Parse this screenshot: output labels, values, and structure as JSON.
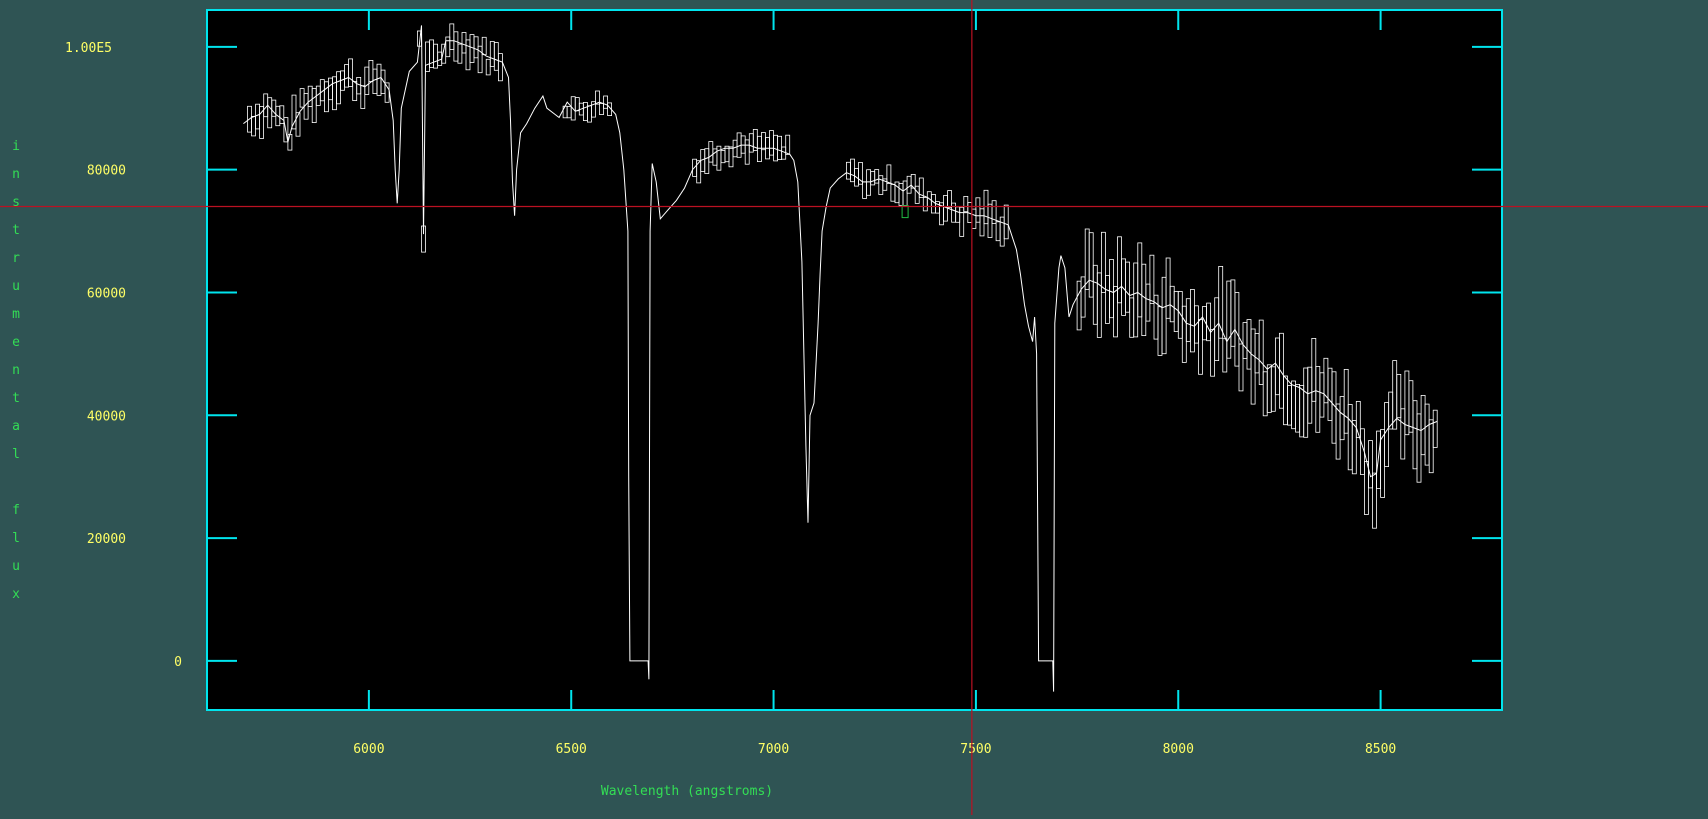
{
  "colors": {
    "background": "#2f5454",
    "plot_bg": "#000000",
    "frame": "#00e5ee",
    "tick_label": "#ffff66",
    "axis_label": "#33dd55",
    "spectrum": "#ffffff",
    "cursor": "#bb1122",
    "marker": "#22bb44"
  },
  "chart_data": {
    "type": "line",
    "xlabel": "Wavelength (angstroms)",
    "ylabel": "instrumental flux",
    "xlim": [
      5600,
      8800
    ],
    "ylim": [
      -8000,
      106000
    ],
    "x_ticks": [
      {
        "value": 6000,
        "label": "6000"
      },
      {
        "value": 6500,
        "label": "6500"
      },
      {
        "value": 7000,
        "label": "7000"
      },
      {
        "value": 7500,
        "label": "7500"
      },
      {
        "value": 8000,
        "label": "8000"
      },
      {
        "value": 8500,
        "label": "8500"
      }
    ],
    "y_ticks": [
      {
        "value": 0,
        "label": "0"
      },
      {
        "value": 20000,
        "label": "20000"
      },
      {
        "value": 40000,
        "label": "40000"
      },
      {
        "value": 60000,
        "label": "60000"
      },
      {
        "value": 80000,
        "label": "80000"
      },
      {
        "value": 100000,
        "label": "1.00E5"
      }
    ],
    "cursor": {
      "x": 7490,
      "y": 74000
    },
    "marker_point": {
      "x": 7325,
      "y": 73500
    },
    "series": [
      {
        "points": [
          [
            5690,
            87500
          ],
          [
            5710,
            88500
          ],
          [
            5730,
            89000
          ],
          [
            5750,
            90500
          ],
          [
            5770,
            89000
          ],
          [
            5790,
            88000
          ],
          [
            5800,
            84500
          ],
          [
            5810,
            87000
          ],
          [
            5830,
            89500
          ],
          [
            5850,
            91000
          ],
          [
            5870,
            92000
          ],
          [
            5890,
            93000
          ],
          [
            5910,
            94000
          ],
          [
            5930,
            94500
          ],
          [
            5950,
            95000
          ],
          [
            5970,
            94000
          ],
          [
            5990,
            93500
          ],
          [
            6010,
            94500
          ],
          [
            6030,
            95000
          ],
          [
            6050,
            93000
          ],
          [
            6060,
            88000
          ],
          [
            6065,
            80000
          ],
          [
            6070,
            74500
          ],
          [
            6075,
            80000
          ],
          [
            6080,
            90000
          ],
          [
            6100,
            96000
          ],
          [
            6120,
            97500
          ],
          [
            6130,
            103500
          ],
          [
            6135,
            69500
          ],
          [
            6140,
            97000
          ],
          [
            6160,
            97500
          ],
          [
            6180,
            98000
          ],
          [
            6190,
            101000
          ],
          [
            6210,
            101000
          ],
          [
            6230,
            100500
          ],
          [
            6250,
            100000
          ],
          [
            6270,
            99500
          ],
          [
            6290,
            98500
          ],
          [
            6310,
            98000
          ],
          [
            6330,
            97500
          ],
          [
            6345,
            95000
          ],
          [
            6350,
            88000
          ],
          [
            6355,
            78000
          ],
          [
            6360,
            72500
          ],
          [
            6365,
            80000
          ],
          [
            6375,
            86000
          ],
          [
            6390,
            87500
          ],
          [
            6410,
            90000
          ],
          [
            6430,
            92000
          ],
          [
            6440,
            90000
          ],
          [
            6460,
            89000
          ],
          [
            6470,
            88500
          ],
          [
            6490,
            91000
          ],
          [
            6510,
            89500
          ],
          [
            6530,
            90000
          ],
          [
            6550,
            90500
          ],
          [
            6570,
            91000
          ],
          [
            6590,
            90500
          ],
          [
            6610,
            89000
          ],
          [
            6620,
            86000
          ],
          [
            6630,
            80000
          ],
          [
            6640,
            70000
          ],
          [
            6642,
            30000
          ],
          [
            6645,
            0
          ],
          [
            6690,
            0
          ],
          [
            6692,
            -3000
          ],
          [
            6695,
            70000
          ],
          [
            6700,
            81000
          ],
          [
            6710,
            78000
          ],
          [
            6720,
            72000
          ],
          [
            6740,
            73500
          ],
          [
            6760,
            75000
          ],
          [
            6780,
            77000
          ],
          [
            6800,
            80000
          ],
          [
            6820,
            81500
          ],
          [
            6840,
            82000
          ],
          [
            6860,
            83000
          ],
          [
            6880,
            83500
          ],
          [
            6900,
            83500
          ],
          [
            6920,
            84000
          ],
          [
            6940,
            84000
          ],
          [
            6960,
            83500
          ],
          [
            6980,
            83500
          ],
          [
            7000,
            83500
          ],
          [
            7020,
            83000
          ],
          [
            7040,
            82500
          ],
          [
            7050,
            81500
          ],
          [
            7060,
            78000
          ],
          [
            7070,
            65000
          ],
          [
            7075,
            50000
          ],
          [
            7080,
            35000
          ],
          [
            7085,
            22500
          ],
          [
            7090,
            40000
          ],
          [
            7100,
            42000
          ],
          [
            7110,
            55000
          ],
          [
            7115,
            63000
          ],
          [
            7120,
            70000
          ],
          [
            7130,
            74000
          ],
          [
            7140,
            77000
          ],
          [
            7160,
            78500
          ],
          [
            7180,
            79500
          ],
          [
            7200,
            79000
          ],
          [
            7220,
            78000
          ],
          [
            7240,
            78000
          ],
          [
            7260,
            78500
          ],
          [
            7280,
            78000
          ],
          [
            7300,
            77500
          ],
          [
            7320,
            76500
          ],
          [
            7340,
            77500
          ],
          [
            7360,
            76000
          ],
          [
            7380,
            75500
          ],
          [
            7400,
            74500
          ],
          [
            7420,
            74000
          ],
          [
            7440,
            73500
          ],
          [
            7460,
            73000
          ],
          [
            7480,
            73000
          ],
          [
            7500,
            72500
          ],
          [
            7520,
            72500
          ],
          [
            7540,
            72000
          ],
          [
            7560,
            71500
          ],
          [
            7580,
            71000
          ],
          [
            7600,
            67000
          ],
          [
            7610,
            63000
          ],
          [
            7620,
            58000
          ],
          [
            7630,
            54500
          ],
          [
            7640,
            52000
          ],
          [
            7645,
            56000
          ],
          [
            7650,
            50000
          ],
          [
            7655,
            0
          ],
          [
            7690,
            0
          ],
          [
            7692,
            -5000
          ],
          [
            7695,
            55000
          ],
          [
            7705,
            64000
          ],
          [
            7710,
            66000
          ],
          [
            7720,
            64000
          ],
          [
            7730,
            56000
          ],
          [
            7740,
            58000
          ],
          [
            7760,
            60500
          ],
          [
            7780,
            62000
          ],
          [
            7800,
            61500
          ],
          [
            7820,
            60500
          ],
          [
            7840,
            60000
          ],
          [
            7860,
            61000
          ],
          [
            7880,
            59500
          ],
          [
            7900,
            60000
          ],
          [
            7920,
            59000
          ],
          [
            7940,
            58500
          ],
          [
            7960,
            57500
          ],
          [
            7980,
            58000
          ],
          [
            8000,
            57000
          ],
          [
            8020,
            55000
          ],
          [
            8040,
            54500
          ],
          [
            8060,
            56000
          ],
          [
            8080,
            53500
          ],
          [
            8100,
            55000
          ],
          [
            8120,
            52000
          ],
          [
            8140,
            54000
          ],
          [
            8160,
            51500
          ],
          [
            8180,
            50000
          ],
          [
            8200,
            49000
          ],
          [
            8220,
            47500
          ],
          [
            8240,
            48500
          ],
          [
            8260,
            46500
          ],
          [
            8280,
            45000
          ],
          [
            8300,
            44500
          ],
          [
            8320,
            43500
          ],
          [
            8340,
            44000
          ],
          [
            8360,
            43500
          ],
          [
            8380,
            42000
          ],
          [
            8400,
            40500
          ],
          [
            8420,
            39500
          ],
          [
            8440,
            38000
          ],
          [
            8460,
            34000
          ],
          [
            8475,
            30000
          ],
          [
            8490,
            30500
          ],
          [
            8500,
            36000
          ],
          [
            8520,
            38000
          ],
          [
            8540,
            39500
          ],
          [
            8560,
            38500
          ],
          [
            8580,
            38000
          ],
          [
            8600,
            37500
          ],
          [
            8620,
            38500
          ],
          [
            8640,
            39000
          ]
        ]
      }
    ]
  }
}
